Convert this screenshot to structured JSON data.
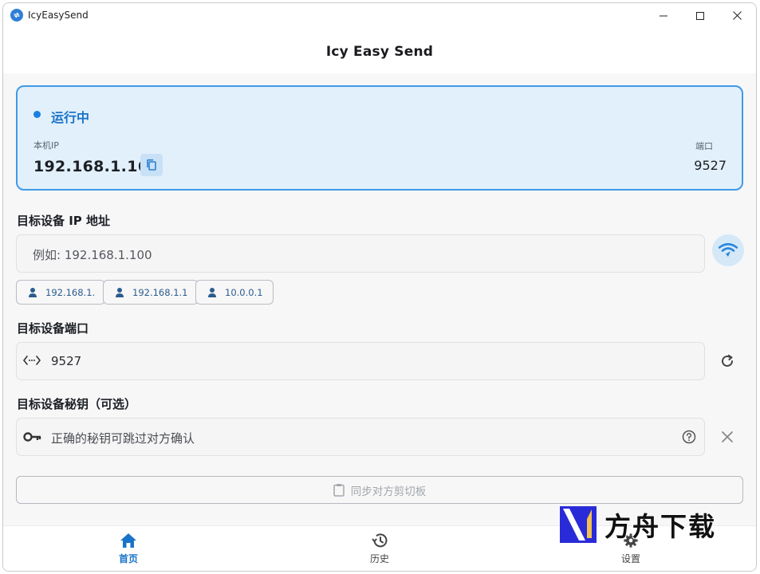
{
  "window": {
    "title": "IcyEasySend"
  },
  "appbar": {
    "title": "Icy Easy Send"
  },
  "status": {
    "text": "运行中",
    "ip_label": "本机IP",
    "ip_value": "192.168.1.16",
    "port_label": "端口",
    "port_value": "9527",
    "accent_color": "#1a73c8"
  },
  "target_ip": {
    "label": "目标设备 IP 地址",
    "placeholder": "例如: 192.168.1.100",
    "recent": [
      "192.168.1.",
      "192.168.1.1",
      "10.0.0.1"
    ]
  },
  "target_port": {
    "label": "目标设备端口",
    "value": "9527"
  },
  "target_key": {
    "label": "目标设备秘钥（可选）",
    "placeholder": "正确的秘钥可跳过对方确认"
  },
  "clipboard_button": {
    "label": "同步对方剪切板"
  },
  "nav": {
    "items": [
      {
        "label": "首页",
        "icon": "home-icon",
        "active": true
      },
      {
        "label": "历史",
        "icon": "history-icon",
        "active": false
      },
      {
        "label": "设置",
        "icon": "settings-icon",
        "active": false
      }
    ]
  },
  "watermark": {
    "text": "方舟下载"
  }
}
